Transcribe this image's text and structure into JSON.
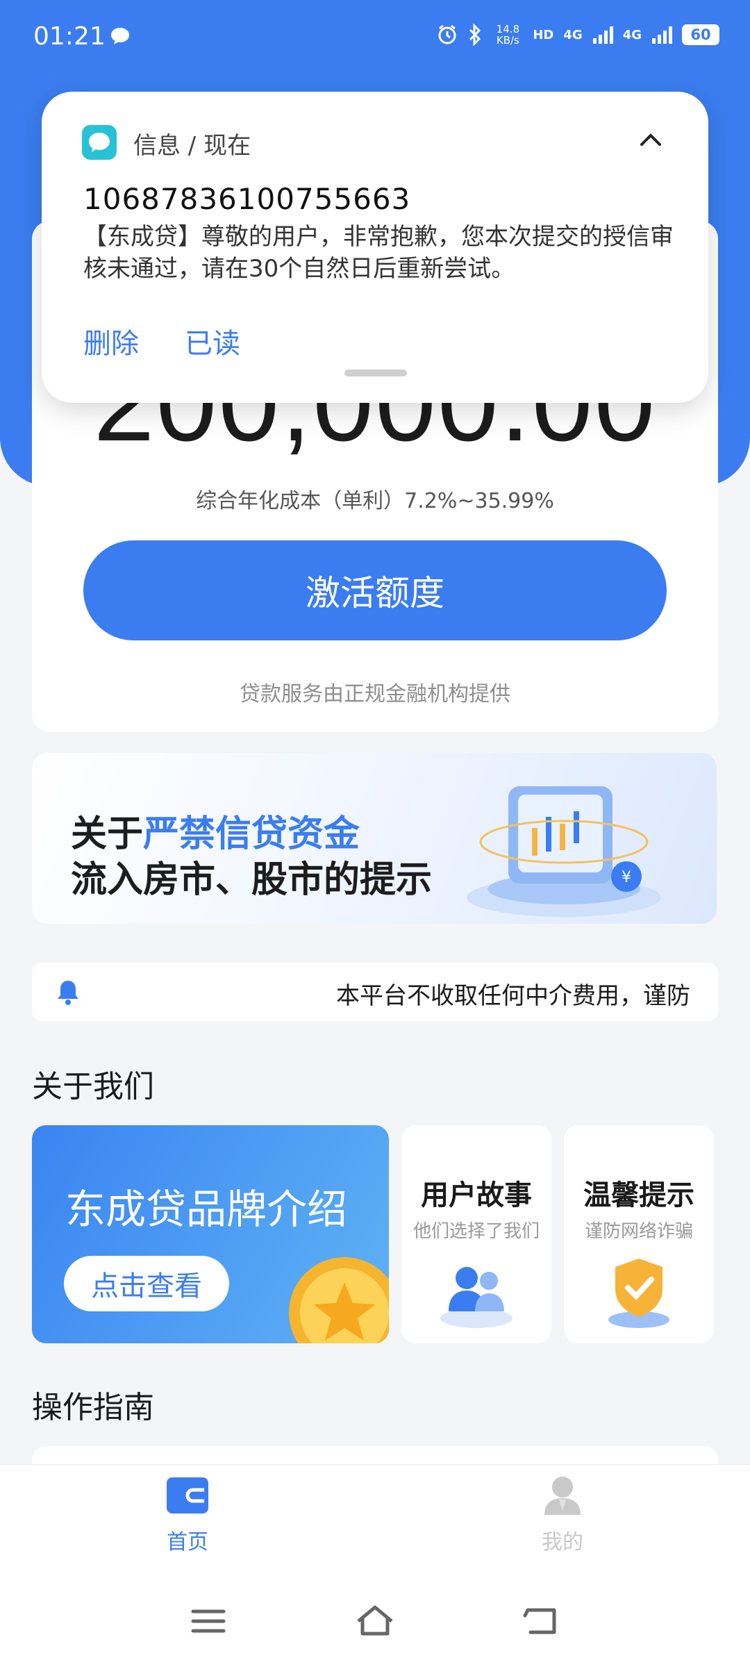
{
  "status_bar": {
    "time": "01:21",
    "net_speed_value": "14.8",
    "net_speed_unit": "KB/s",
    "hd_label": "HD",
    "sim1_label": "4G",
    "sim2_label": "4G",
    "battery": "60"
  },
  "notification": {
    "app_name": "信息 / 现在",
    "sender": "10687836100755663",
    "body": "【东成贷】尊敬的用户，非常抱歉，您本次提交的授信审核未通过，请在30个自然日后重新尝试。",
    "delete_label": "删除",
    "read_label": "已读"
  },
  "credit": {
    "amount": "200,000.00",
    "rate": "综合年化成本（单利）7.2%~35.99%",
    "activate_label": "激活额度",
    "provider_note": "贷款服务由正规金融机构提供"
  },
  "banner": {
    "line1_prefix": "关于",
    "line1_highlight": "严禁信贷资金",
    "line2": "流入房市、股市的提示"
  },
  "notice": {
    "text": "本平台不收取任何中介费用，谨防"
  },
  "about": {
    "title": "关于我们",
    "brand_title": "东成贷品牌介绍",
    "brand_button": "点击查看",
    "story_title": "用户故事",
    "story_sub": "他们选择了我们",
    "tips_title": "温馨提示",
    "tips_sub": "谨防网络诈骗"
  },
  "guide": {
    "title": "操作指南"
  },
  "bottom_nav": {
    "home_label": "首页",
    "mine_label": "我的"
  },
  "colors": {
    "primary": "#3b7df0",
    "background": "#f4f5f7"
  }
}
